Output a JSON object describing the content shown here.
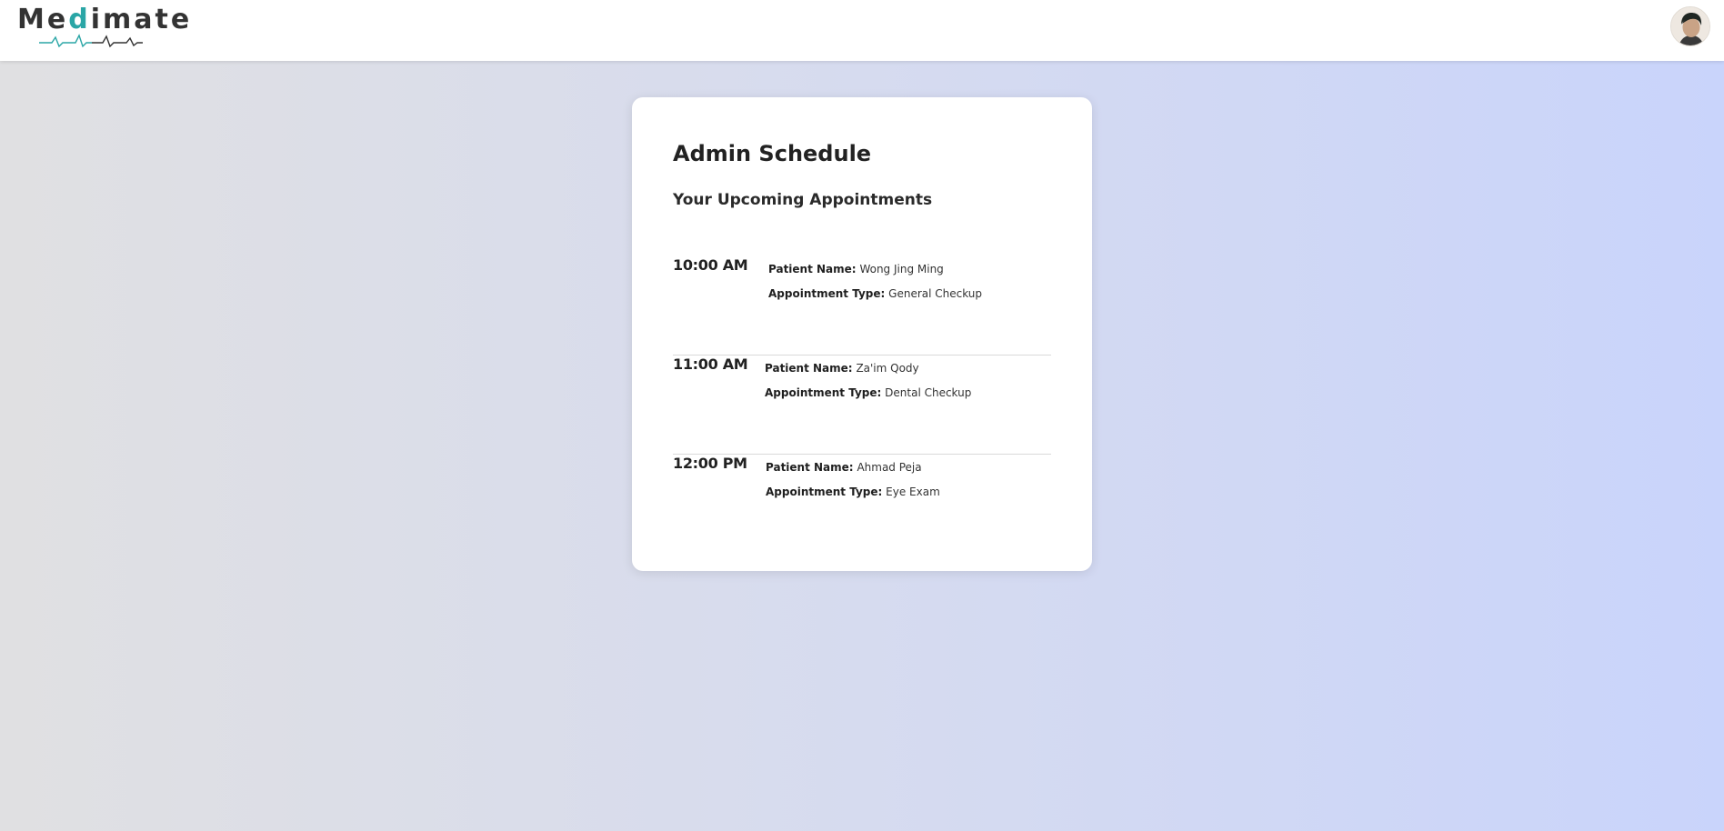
{
  "brand": {
    "name_prefix": "Me",
    "name_accent": "d",
    "name_suffix": "imate",
    "accent_color": "#2aa6a6"
  },
  "header": {
    "avatar_icon": "user-avatar"
  },
  "schedule": {
    "title": "Admin Schedule",
    "subtitle": "Your Upcoming Appointments",
    "patient_label": "Patient Name:",
    "type_label": "Appointment Type:",
    "appointments": [
      {
        "time": "10:00 AM",
        "patient": "Wong Jing Ming",
        "type": "General Checkup"
      },
      {
        "time": "11:00 AM",
        "patient": "Za'im Qody",
        "type": "Dental Checkup"
      },
      {
        "time": "12:00 PM",
        "patient": "Ahmad Peja",
        "type": "Eye Exam"
      }
    ]
  }
}
